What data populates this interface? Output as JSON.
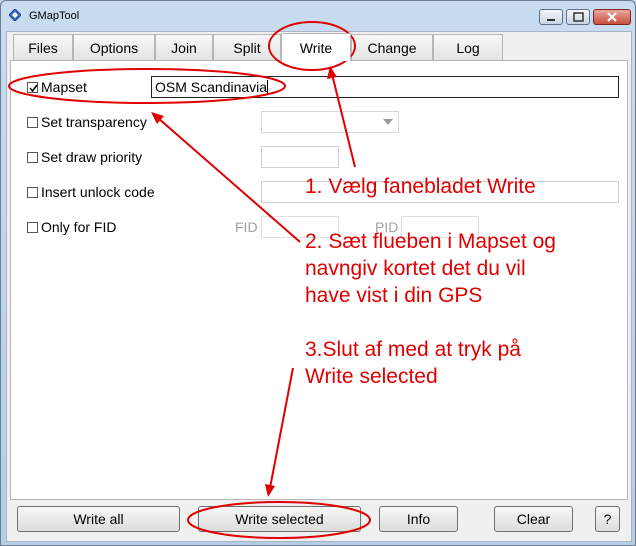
{
  "window": {
    "title": "GMapTool"
  },
  "tabs": [
    {
      "label": "Files"
    },
    {
      "label": "Options"
    },
    {
      "label": "Join"
    },
    {
      "label": "Split"
    },
    {
      "label": "Write"
    },
    {
      "label": "Change"
    },
    {
      "label": "Log"
    }
  ],
  "active_tab": "Write",
  "write_panel": {
    "mapset": {
      "label": "Mapset",
      "checked": true,
      "value": "OSM Scandinavia"
    },
    "transparency": {
      "label": "Set transparency",
      "checked": false,
      "value": ""
    },
    "draw_priority": {
      "label": "Set draw priority",
      "checked": false,
      "value": ""
    },
    "unlock_code": {
      "label": "Insert unlock code",
      "checked": false,
      "value": ""
    },
    "fid": {
      "label": "Only for FID",
      "checked": false,
      "fid_label": "FID",
      "pid_label": "PID",
      "fid_value": "",
      "pid_value": ""
    }
  },
  "buttons": {
    "write_all": "Write all",
    "write_selected": "Write selected",
    "info": "Info",
    "clear": "Clear",
    "help": "?"
  },
  "annotations": {
    "step1": "1. Vælg fanebladet Write",
    "step2_line1": "2. Sæt flueben i Mapset og",
    "step2_line2": "navngiv kortet det du vil",
    "step2_line3": "have vist i din GPS",
    "step3_line1": "3.Slut af med at tryk på",
    "step3_line2": "Write selected",
    "color": "#e00000"
  }
}
